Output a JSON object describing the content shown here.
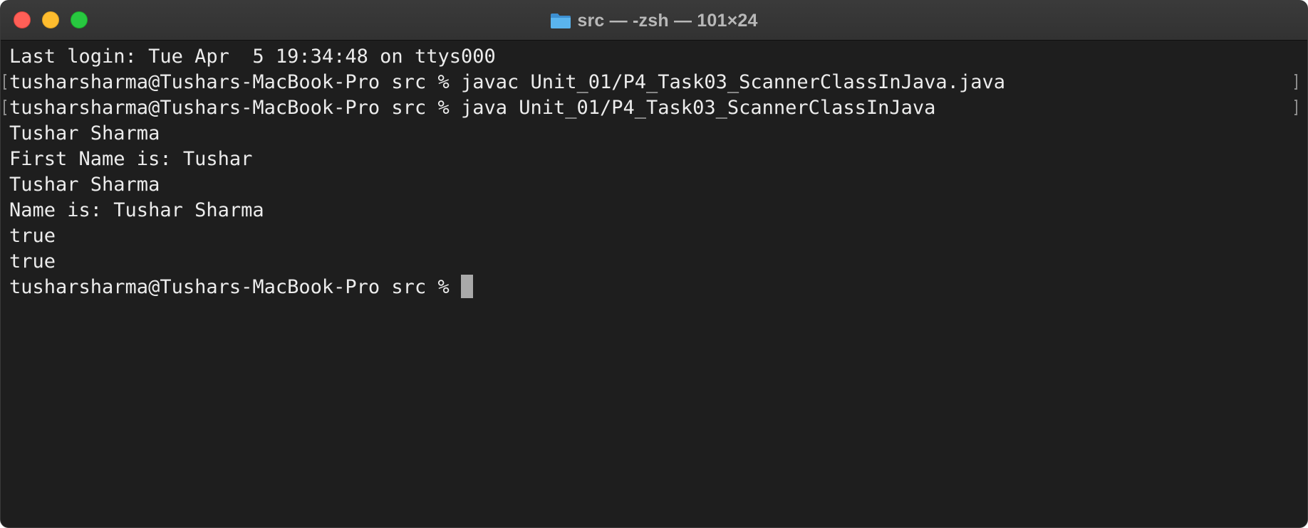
{
  "window": {
    "title": "src — -zsh — 101×24",
    "title_icon": "folder-icon"
  },
  "terminal": {
    "lines": [
      "Last login: Tue Apr  5 19:34:48 on ttys000",
      "tusharsharma@Tushars-MacBook-Pro src % javac Unit_01/P4_Task03_ScannerClassInJava.java",
      "tusharsharma@Tushars-MacBook-Pro src % java Unit_01/P4_Task03_ScannerClassInJava",
      "Tushar Sharma",
      "First Name is: Tushar",
      "Tushar Sharma",
      "Name is: Tushar Sharma",
      "true",
      "true"
    ],
    "prompt": "tusharsharma@Tushars-MacBook-Pro src % "
  },
  "colors": {
    "background": "#1e1e1e",
    "text": "#ececec",
    "close": "#ff5f57",
    "minimize": "#febc2e",
    "maximize": "#28c840",
    "folder": "#4aa8e8"
  }
}
